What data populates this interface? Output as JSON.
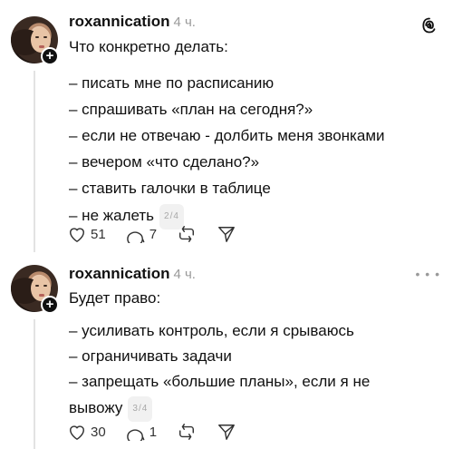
{
  "posts": [
    {
      "username": "roxannication",
      "time": "4 ч.",
      "lines": [
        "Что конкретно делать:",
        "",
        "– писать мне по расписанию",
        "– спрашивать «план на сегодня?»",
        "– если не отвечаю - долбить меня звонками",
        "– вечером «что сделано?»",
        "– ставить галочки в таблице",
        "– не жалеть"
      ],
      "page_badge": "2/4",
      "likes": "51",
      "replies": "7",
      "corner_icon": "threads-logo-icon"
    },
    {
      "username": "roxannication",
      "time": "4 ч.",
      "lines": [
        "Будет право:",
        "",
        "– усиливать контроль, если я срываюсь",
        "– ограничивать задачи",
        "– запрещать «большие планы», если я не",
        "вывожу"
      ],
      "page_badge": "3/4",
      "likes": "30",
      "replies": "1",
      "corner_icon": "more-icon"
    }
  ]
}
